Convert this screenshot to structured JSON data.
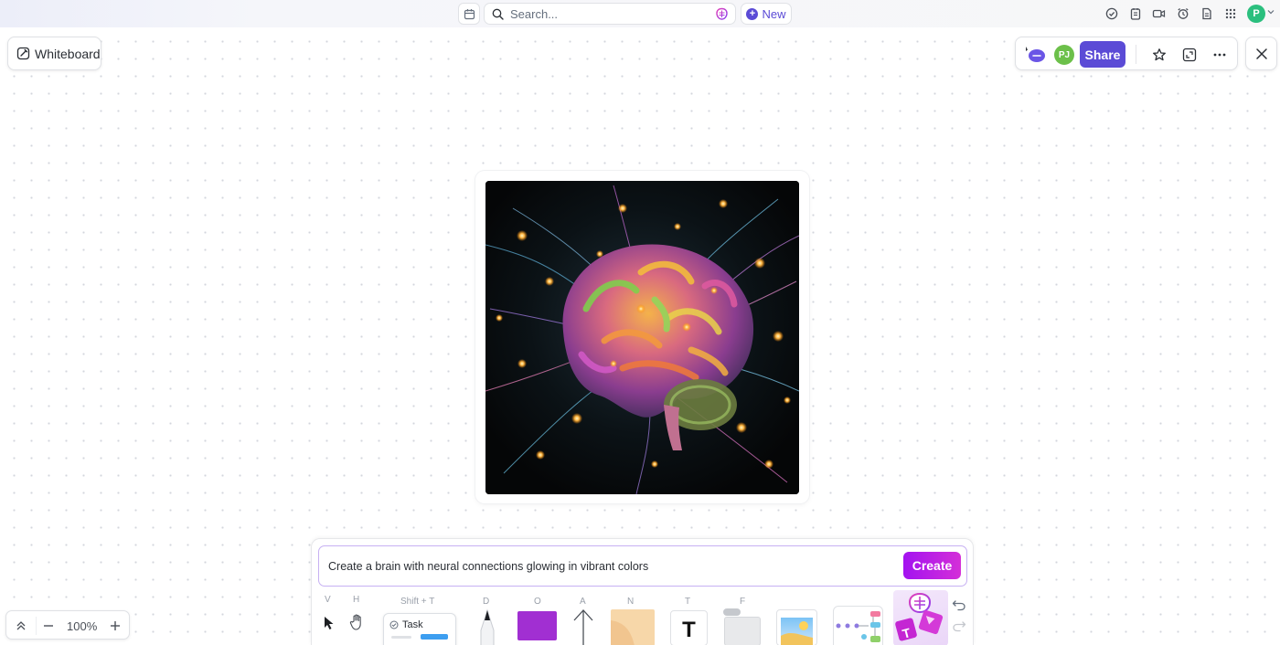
{
  "topbar": {
    "search_placeholder": "Search...",
    "new_label": "New",
    "icons": [
      "calendar-icon",
      "search-icon",
      "ai-brain-icon",
      "check-circle-icon",
      "notepad-icon",
      "video-icon",
      "alarm-clock-icon",
      "document-icon",
      "apps-grid-icon"
    ],
    "user_initial": "P",
    "colors": {
      "accent": "#5b4bd6",
      "avatar": "#2bbf7e"
    }
  },
  "header": {
    "view_label": "Whiteboard"
  },
  "actions": {
    "collaborator_initials": "PJ",
    "share_label": "Share",
    "icons": [
      "presence-cursor-icon",
      "star-icon",
      "fullscreen-icon",
      "more-options-icon",
      "close-icon"
    ]
  },
  "canvas": {
    "generated_image": "brain with glowing neural connections"
  },
  "ai_prompt": {
    "prompt_text": "Create a brain with neural connections glowing in vibrant colors",
    "create_label": "Create",
    "colors": {
      "gradient_start": "#a312f0",
      "gradient_end": "#d42fd8"
    }
  },
  "toolbar": {
    "tools": [
      {
        "name": "select",
        "shortcut": "V"
      },
      {
        "name": "hand",
        "shortcut": "H"
      },
      {
        "name": "task",
        "shortcut": "Shift + T",
        "label": "Task"
      },
      {
        "name": "pen",
        "shortcut": "D"
      },
      {
        "name": "shape",
        "shortcut": "O"
      },
      {
        "name": "connector",
        "shortcut": "A"
      },
      {
        "name": "sticky-note",
        "shortcut": "N"
      },
      {
        "name": "text",
        "shortcut": "T",
        "label": "T"
      },
      {
        "name": "frame",
        "shortcut": "F"
      },
      {
        "name": "image",
        "shortcut": ""
      },
      {
        "name": "diagram",
        "shortcut": ""
      },
      {
        "name": "ai-generate",
        "shortcut": ""
      }
    ]
  },
  "zoom": {
    "level": "100%"
  }
}
